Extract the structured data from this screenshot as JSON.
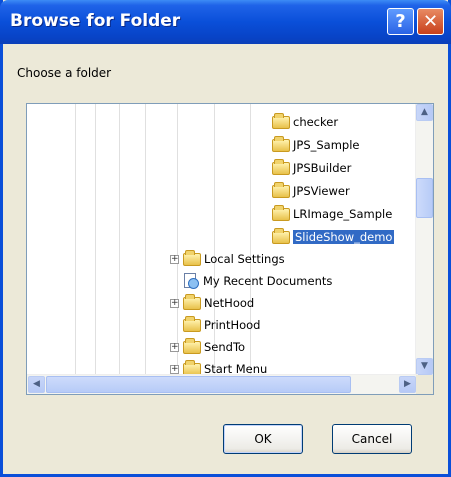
{
  "window": {
    "title": "Browse for Folder",
    "help_glyph": "?",
    "close_glyph": "✕"
  },
  "prompt": "Choose a folder",
  "tree": {
    "items": [
      {
        "label": "checker",
        "icon": "folder-icon",
        "selected": false
      },
      {
        "label": "JPS_Sample",
        "icon": "folder-icon",
        "selected": false
      },
      {
        "label": "JPSBuilder",
        "icon": "folder-icon",
        "selected": false
      },
      {
        "label": "JPSViewer",
        "icon": "folder-icon",
        "selected": false
      },
      {
        "label": "LRImage_Sample",
        "icon": "folder-icon",
        "selected": false
      },
      {
        "label": "SlideShow_demo",
        "icon": "folder-icon",
        "selected": true
      },
      {
        "label": "Local Settings",
        "icon": "folder-icon",
        "selected": false,
        "expander": "+"
      },
      {
        "label": "My Recent Documents",
        "icon": "recent-documents-icon",
        "selected": false
      },
      {
        "label": "NetHood",
        "icon": "folder-icon",
        "selected": false,
        "expander": "+"
      },
      {
        "label": "PrintHood",
        "icon": "folder-icon",
        "selected": false
      },
      {
        "label": "SendTo",
        "icon": "folder-icon",
        "selected": false,
        "expander": "+"
      },
      {
        "label": "Start Menu",
        "icon": "folder-icon",
        "selected": false,
        "expander": "+"
      }
    ]
  },
  "scrollbar": {
    "up_glyph": "▲",
    "down_glyph": "▼",
    "left_glyph": "◀",
    "right_glyph": "▶"
  },
  "buttons": {
    "ok": "OK",
    "cancel": "Cancel"
  },
  "colors": {
    "titlebar": "#0a4fd9",
    "selection": "#316ac5",
    "dialog_face": "#ece9d8"
  }
}
